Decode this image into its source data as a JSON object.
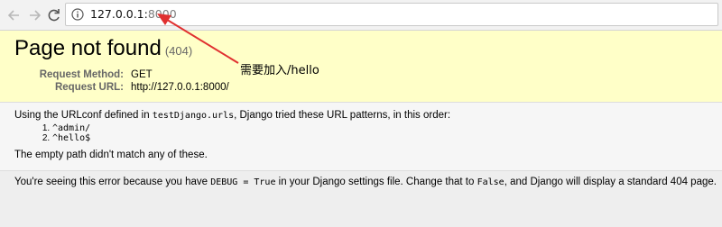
{
  "browser": {
    "url_host": "127.0.0.1:",
    "url_port": "8000"
  },
  "summary": {
    "title": "Page not found",
    "status": "(404)",
    "request_method_label": "Request Method:",
    "request_method_value": "GET",
    "request_url_label": "Request URL:",
    "request_url_value": "http://127.0.0.1:8000/"
  },
  "annotation": {
    "text": "需要加入/hello",
    "color": "#e03030"
  },
  "info": {
    "intro_before": "Using the URLconf defined in ",
    "intro_module": "testDjango.urls",
    "intro_after": ", Django tried these URL patterns, in this order:",
    "patterns": [
      "^admin/",
      "^hello$"
    ],
    "empty_path": "The empty path didn't match any of these."
  },
  "explanation": {
    "before": "You're seeing this error because you have ",
    "code_debug": "DEBUG = True",
    "middle": " in your Django settings file. Change that to ",
    "code_false": "False",
    "after": ", and Django will display a standard 404 page."
  },
  "colors": {
    "summary_bg": "#ffffc8",
    "info_bg": "#f6f6f6",
    "explanation_bg": "#eeeeee"
  }
}
